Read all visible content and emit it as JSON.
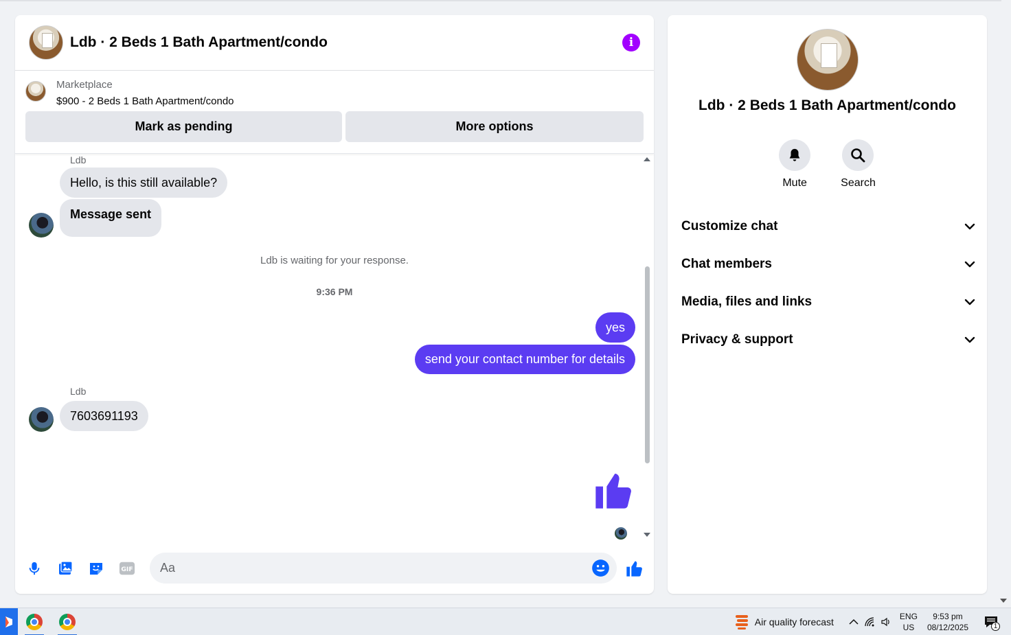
{
  "chat": {
    "title": "Ldb · 2 Beds 1 Bath Apartment/condo",
    "marketplace_label": "Marketplace",
    "listing": "$900 - 2 Beds 1 Bath Apartment/condo",
    "mark_pending_label": "Mark as pending",
    "more_options_label": "More options"
  },
  "messages": {
    "sender_top": "Ldb",
    "msg1": "Hello, is this still available?",
    "msg2": "Message sent",
    "waiting_notice": "Ldb is waiting for your response.",
    "timestamp": "9:36 PM",
    "out1": "yes",
    "out2": "send your contact number for details",
    "sender_bottom": "Ldb",
    "msg3": "7603691193"
  },
  "composer": {
    "placeholder": "Aa"
  },
  "details": {
    "title": "Ldb · 2 Beds 1 Bath Apartment/condo",
    "mute_label": "Mute",
    "search_label": "Search",
    "sections": [
      {
        "label": "Customize chat"
      },
      {
        "label": "Chat members"
      },
      {
        "label": "Media, files and links"
      },
      {
        "label": "Privacy & support"
      }
    ]
  },
  "taskbar": {
    "weather_label": "Air quality forecast",
    "lang_top": "ENG",
    "lang_bottom": "US",
    "time": "9:53 pm",
    "date": "08/12/2025",
    "notification_count": "1"
  },
  "colors": {
    "accent": "#5b3cf2",
    "messenger_blue": "#0866ff",
    "info_purple": "#a200ff"
  }
}
